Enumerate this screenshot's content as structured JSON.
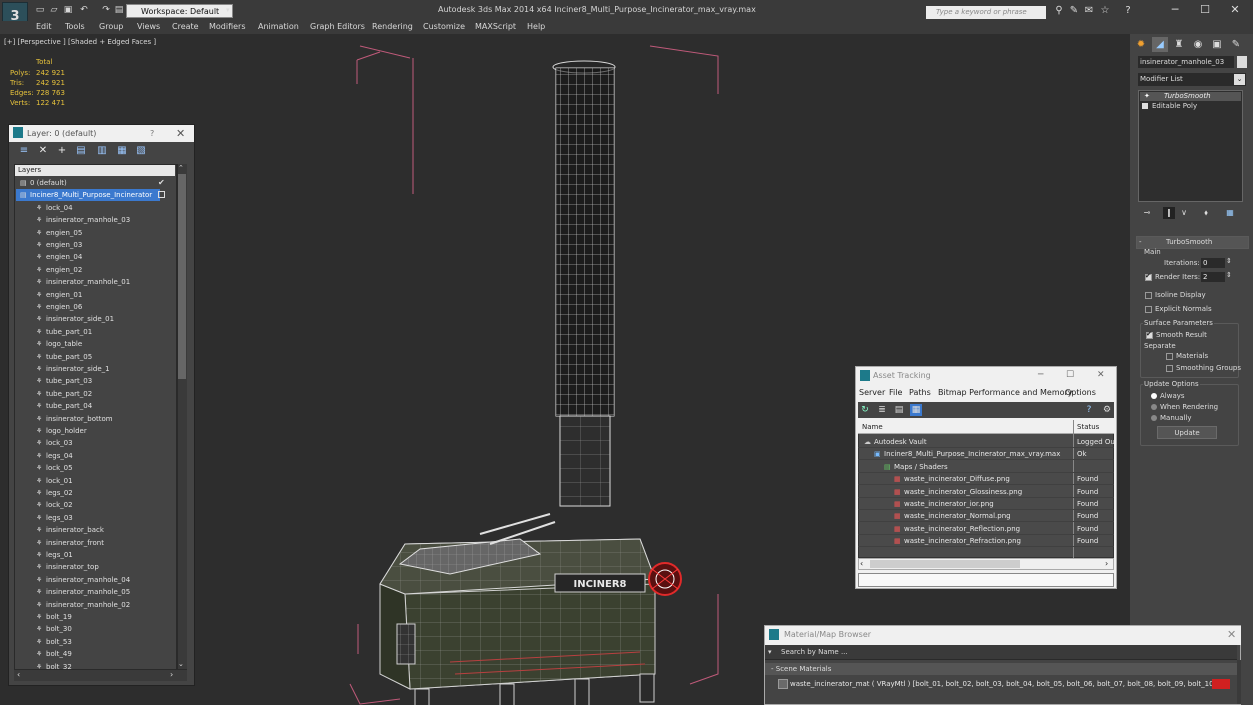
{
  "app": {
    "logo_glyph": "3",
    "title": "Autodesk 3ds Max  2014 x64     Inciner8_Multi_Purpose_Incinerator_max_vray.max",
    "workspace": "Workspace: Default",
    "search_placeholder": "Type a keyword or phrase",
    "accent_color": "#3b79ce"
  },
  "menu": [
    "Edit",
    "Tools",
    "Group",
    "Views",
    "Create",
    "Modifiers",
    "Animation",
    "Graph Editors",
    "Rendering",
    "Customize",
    "MAXScript",
    "Help"
  ],
  "viewport": {
    "label": "[+] [Perspective ] [Shaded + Edged Faces ]",
    "stats": {
      "header": "Total",
      "rows": [
        {
          "label": "Polys:",
          "value": "242 921"
        },
        {
          "label": "Tris:",
          "value": "242 921"
        },
        {
          "label": "Edges:",
          "value": "728 763"
        },
        {
          "label": "Verts:",
          "value": "122 471"
        }
      ]
    },
    "object_logo_text": "INCINER8"
  },
  "layer_panel": {
    "title": "Layer: 0 (default)",
    "help": "?",
    "close": "✕",
    "header": "Layers",
    "layers": [
      {
        "name": "0 (default)",
        "type": "layer"
      },
      {
        "name": "Inciner8_Multi_Purpose_Incinerator",
        "type": "layer",
        "selected": true
      },
      {
        "name": "lock_04",
        "type": "obj"
      },
      {
        "name": "insinerator_manhole_03",
        "type": "obj"
      },
      {
        "name": "engien_05",
        "type": "obj"
      },
      {
        "name": "engien_03",
        "type": "obj"
      },
      {
        "name": "engien_04",
        "type": "obj"
      },
      {
        "name": "engien_02",
        "type": "obj"
      },
      {
        "name": "insinerator_manhole_01",
        "type": "obj"
      },
      {
        "name": "engien_01",
        "type": "obj"
      },
      {
        "name": "engien_06",
        "type": "obj"
      },
      {
        "name": "insinerator_side_01",
        "type": "obj"
      },
      {
        "name": "tube_part_01",
        "type": "obj"
      },
      {
        "name": "logo_table",
        "type": "obj"
      },
      {
        "name": "tube_part_05",
        "type": "obj"
      },
      {
        "name": "insinerator_side_1",
        "type": "obj"
      },
      {
        "name": "tube_part_03",
        "type": "obj"
      },
      {
        "name": "tube_part_02",
        "type": "obj"
      },
      {
        "name": "tube_part_04",
        "type": "obj"
      },
      {
        "name": "insinerator_bottom",
        "type": "obj"
      },
      {
        "name": "logo_holder",
        "type": "obj"
      },
      {
        "name": "lock_03",
        "type": "obj"
      },
      {
        "name": "legs_04",
        "type": "obj"
      },
      {
        "name": "lock_05",
        "type": "obj"
      },
      {
        "name": "lock_01",
        "type": "obj"
      },
      {
        "name": "legs_02",
        "type": "obj"
      },
      {
        "name": "lock_02",
        "type": "obj"
      },
      {
        "name": "legs_03",
        "type": "obj"
      },
      {
        "name": "insinerator_back",
        "type": "obj"
      },
      {
        "name": "insinerator_front",
        "type": "obj"
      },
      {
        "name": "legs_01",
        "type": "obj"
      },
      {
        "name": "insinerator_top",
        "type": "obj"
      },
      {
        "name": "insinerator_manhole_04",
        "type": "obj"
      },
      {
        "name": "insinerator_manhole_05",
        "type": "obj"
      },
      {
        "name": "insinerator_manhole_02",
        "type": "obj"
      },
      {
        "name": "bolt_19",
        "type": "obj"
      },
      {
        "name": "bolt_30",
        "type": "obj"
      },
      {
        "name": "bolt_53",
        "type": "obj"
      },
      {
        "name": "bolt_49",
        "type": "obj"
      },
      {
        "name": "bolt_32",
        "type": "obj"
      }
    ]
  },
  "command_panel": {
    "object_name": "insinerator_manhole_03",
    "modifier_list": "Modifier List",
    "stack": [
      "TurboSmooth",
      "Editable Poly"
    ],
    "turbosmooth": {
      "title": "TurboSmooth",
      "main": "Main",
      "iterations_label": "Iterations:",
      "iterations": "0",
      "render_iters_label": "Render Iters:",
      "render_iters": "2",
      "isoline": "Isoline Display",
      "explicit": "Explicit Normals",
      "surface": "Surface Parameters",
      "smooth_result": "Smooth Result",
      "separate": "Separate",
      "materials": "Materials",
      "smoothing_groups": "Smoothing Groups",
      "update_options": "Update Options",
      "always": "Always",
      "when_rendering": "When Rendering",
      "manually": "Manually",
      "update": "Update"
    }
  },
  "asset_tracking": {
    "title": "Asset Tracking",
    "menu": [
      "Server",
      "File",
      "Paths",
      "Bitmap Performance and Memory",
      "Options"
    ],
    "columns": [
      "Name",
      "Status"
    ],
    "rows": [
      {
        "name": "Autodesk Vault",
        "status": "Logged Ou",
        "indent": 0
      },
      {
        "name": "Inciner8_Multi_Purpose_Incinerator_max_vray.max",
        "status": "Ok",
        "indent": 1
      },
      {
        "name": "Maps / Shaders",
        "status": "",
        "indent": 2
      },
      {
        "name": "waste_incinerator_Diffuse.png",
        "status": "Found",
        "indent": 3
      },
      {
        "name": "waste_incinerator_Glossiness.png",
        "status": "Found",
        "indent": 3
      },
      {
        "name": "waste_incinerator_ior.png",
        "status": "Found",
        "indent": 3
      },
      {
        "name": "waste_incinerator_Normal.png",
        "status": "Found",
        "indent": 3
      },
      {
        "name": "waste_incinerator_Reflection.png",
        "status": "Found",
        "indent": 3
      },
      {
        "name": "waste_incinerator_Refraction.png",
        "status": "Found",
        "indent": 3
      }
    ]
  },
  "material_browser": {
    "title": "Material/Map Browser",
    "search": "Search by Name ...",
    "section": "- Scene Materials",
    "item": "waste_incinerator_mat  ( VRayMtl ) [bolt_01, bolt_02, bolt_03, bolt_04, bolt_05, bolt_06, bolt_07, bolt_08, bolt_09, bolt_10, bolt_"
  }
}
